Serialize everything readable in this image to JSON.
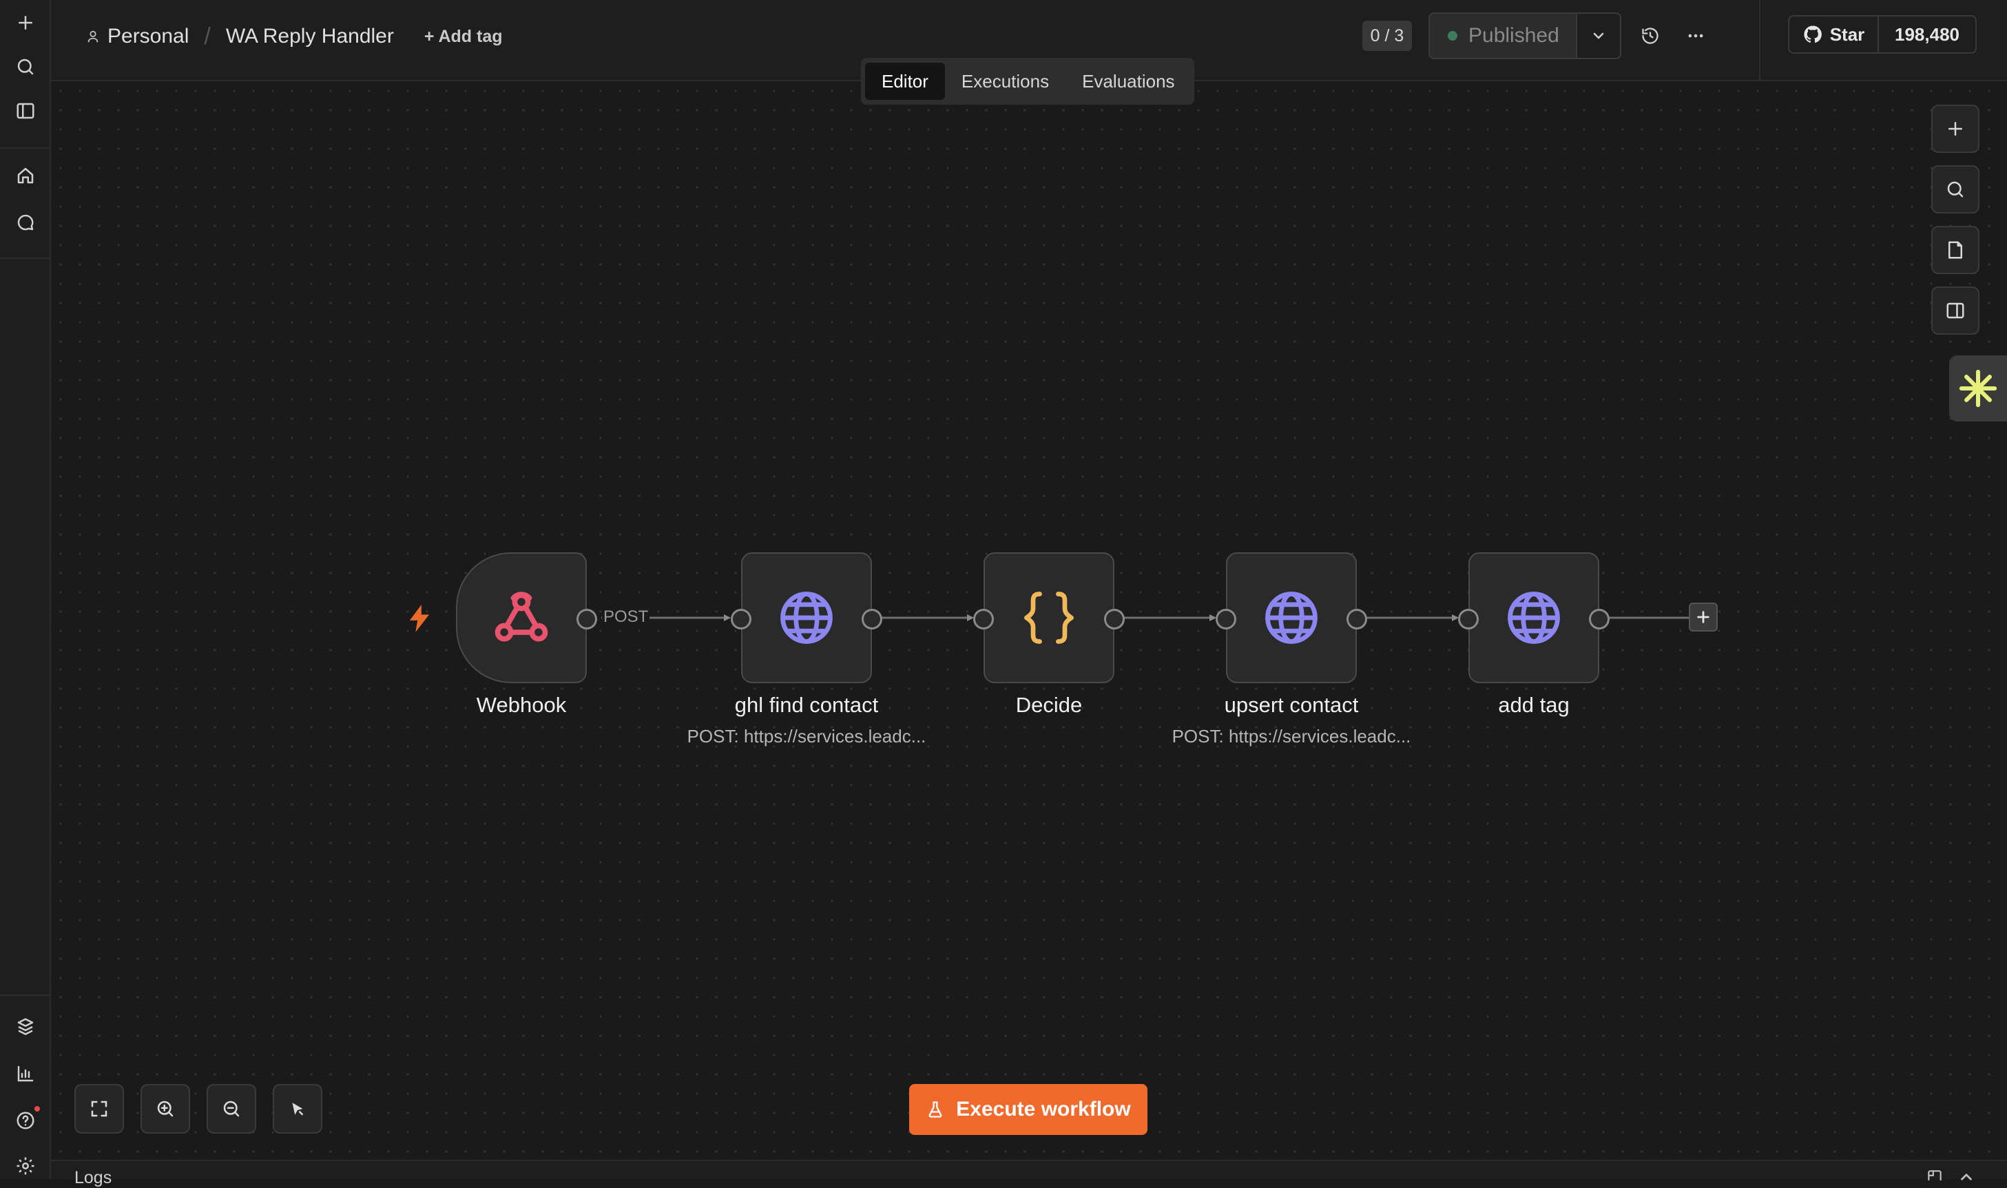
{
  "header": {
    "project": "Personal",
    "workflow_name": "WA Reply Handler",
    "add_tag": "+ Add tag",
    "counter": "0 / 3",
    "publish_status": "Published",
    "github_star": "Star",
    "github_count": "198,480"
  },
  "tabs": [
    {
      "label": "Editor",
      "active": true
    },
    {
      "label": "Executions",
      "active": false
    },
    {
      "label": "Evaluations",
      "active": false
    }
  ],
  "workflow": {
    "nodes": [
      {
        "name": "Webhook",
        "subtitle": "",
        "icon": "webhook-icon"
      },
      {
        "name": "ghl find contact",
        "subtitle": "POST: https://services.leadc...",
        "icon": "globe-icon"
      },
      {
        "name": "Decide",
        "subtitle": "",
        "icon": "code-braces-icon"
      },
      {
        "name": "upsert contact",
        "subtitle": "POST: https://services.leadc...",
        "icon": "globe-icon"
      },
      {
        "name": "add tag",
        "subtitle": "",
        "icon": "globe-icon"
      }
    ],
    "edge_label": "POST"
  },
  "actions": {
    "execute": "Execute workflow"
  },
  "logs": {
    "label": "Logs"
  },
  "colors": {
    "accent": "#ef6a2c",
    "webhook": "#e8546e",
    "http": "#8c86f0",
    "code": "#f1b85a",
    "assistant": "#e7f07a"
  }
}
